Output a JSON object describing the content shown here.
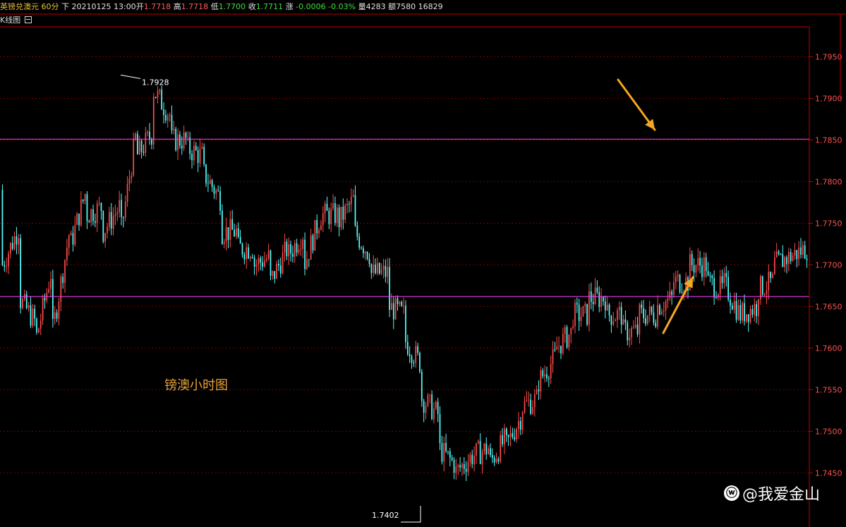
{
  "header": {
    "symbol": "英镑兑澳元",
    "period": "60分",
    "direction": "下",
    "date_time": "20210125 13:00",
    "open_label": "开",
    "open": "1.7718",
    "high_label": "高",
    "high": "1.7718",
    "low_label": "低",
    "low": "1.7700",
    "close_label": "收",
    "close": "1.7711",
    "change_label": "涨",
    "change": "-0.0006",
    "change_pct": "-0.03%",
    "volume_label": "量",
    "volume": "4283",
    "amount_label": "额",
    "amount": "7580",
    "extra": "16829"
  },
  "subbar": {
    "label": "K线图",
    "icon": "collapse-icon"
  },
  "annotation": {
    "text": "镑澳小时图",
    "color": "#e8a33a"
  },
  "watermark": {
    "text": "@我爱金山",
    "icon": "weibo-icon"
  },
  "colors": {
    "up": "#ff4a4a",
    "down": "#54ffff",
    "grid": "#7a0000",
    "axis": "#c00000",
    "hline": "#ff3cff",
    "arrow": "#f5a623"
  },
  "chart_data": {
    "type": "candlestick",
    "title": "",
    "xlabel": "",
    "ylabel": "",
    "ylim": [
      1.7385,
      1.7986
    ],
    "yticks": [
      "1.7950",
      "1.7900",
      "1.7850",
      "1.7800",
      "1.7750",
      "1.7700",
      "1.7650",
      "1.7600",
      "1.7550",
      "1.7500",
      "1.7450"
    ],
    "horizontal_lines": [
      1.7851,
      1.7662
    ],
    "extreme_labels": [
      {
        "kind": "high",
        "value": "1.7928"
      },
      {
        "kind": "low",
        "value": "1.7402"
      }
    ],
    "anchors": [
      [
        1.779,
        1.77
      ],
      [
        1.7745,
        1.766
      ],
      [
        1.763,
        1.761
      ],
      [
        1.77,
        1.762
      ],
      [
        1.774,
        1.772
      ],
      [
        1.779,
        1.776
      ],
      [
        1.777,
        1.774
      ],
      [
        1.777,
        1.773
      ],
      [
        1.786,
        1.783
      ],
      [
        1.786,
        1.791
      ],
      [
        1.788,
        1.785
      ],
      [
        1.785,
        1.784
      ],
      [
        1.783,
        1.781
      ],
      [
        1.778,
        1.774
      ],
      [
        1.774,
        1.772
      ],
      [
        1.772,
        1.77
      ],
      [
        1.771,
        1.768
      ],
      [
        1.772,
        1.771
      ],
      [
        1.774,
        1.77
      ],
      [
        1.776,
        1.776
      ],
      [
        1.776,
        1.775
      ],
      [
        1.778,
        1.774
      ],
      [
        1.771,
        1.769
      ],
      [
        1.769,
        1.765
      ],
      [
        1.764,
        1.761
      ],
      [
        1.758,
        1.754
      ],
      [
        1.752,
        1.748
      ],
      [
        1.746,
        1.745
      ],
      [
        1.747,
        1.747
      ],
      [
        1.748,
        1.746
      ],
      [
        1.749,
        1.748
      ],
      [
        1.752,
        1.753
      ],
      [
        1.754,
        1.756
      ],
      [
        1.759,
        1.76
      ],
      [
        1.762,
        1.764
      ],
      [
        1.764,
        1.766
      ],
      [
        1.766,
        1.764
      ],
      [
        1.764,
        1.762
      ],
      [
        1.762,
        1.764
      ],
      [
        1.764,
        1.765
      ],
      [
        1.766,
        1.768
      ],
      [
        1.768,
        1.77
      ],
      [
        1.77,
        1.768
      ],
      [
        1.767,
        1.768
      ],
      [
        1.764,
        1.764
      ],
      [
        1.765,
        1.767
      ],
      [
        1.768,
        1.77
      ],
      [
        1.771,
        1.771
      ],
      [
        1.772,
        1.772
      ]
    ],
    "candle_count": 400
  }
}
